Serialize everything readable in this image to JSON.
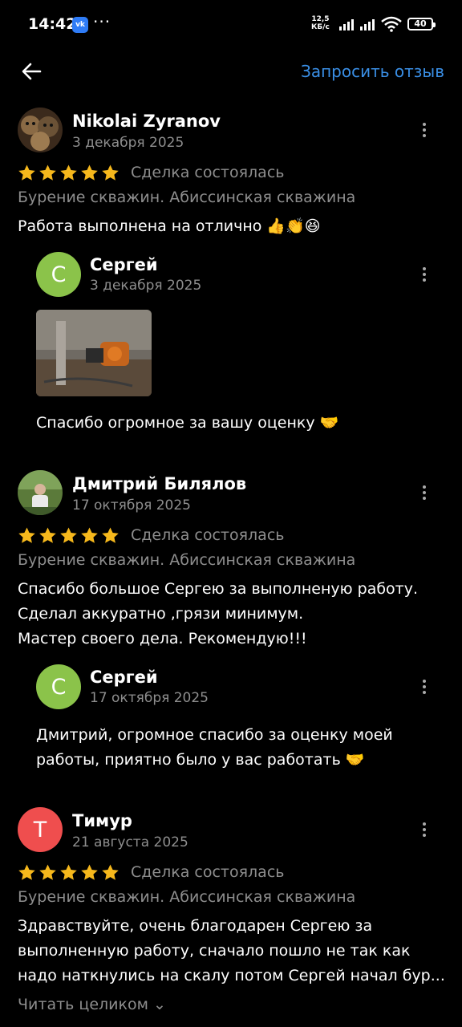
{
  "status_bar": {
    "time": "14:42",
    "app_badge": "vk",
    "more": "···",
    "net_speed_value": "12,5",
    "net_speed_unit": "КБ/с",
    "battery": "40",
    "icons": [
      "signal-icon",
      "signal-icon",
      "wifi-icon",
      "battery-icon"
    ]
  },
  "header": {
    "back_icon": "arrow-left-icon",
    "request_review": "Запросить отзыв"
  },
  "colors": {
    "accent": "#3a8fe6",
    "star": "#f6b81c",
    "avatar_green": "#8bc34a",
    "avatar_red": "#ef4e4e",
    "muted_text": "#8e8e8e"
  },
  "reviews": [
    {
      "author": "Nikolai Zyranov",
      "date": "3 декабря 2025",
      "rating": 5,
      "deal_status": "Сделка состоялась",
      "category": "Бурение скважин. Абиссинская скважина",
      "text": [
        "Работа выполнена на отлично 👍👏😆"
      ],
      "reply": {
        "author": "Сергей",
        "avatar_letter": "С",
        "date": "3 декабря 2025",
        "text": [
          "Спасибо огромное за вашу оценку 🤝"
        ]
      }
    },
    {
      "author": "Дмитрий Билялов",
      "date": "17 октября 2025",
      "rating": 5,
      "deal_status": "Сделка состоялась",
      "category": "Бурение скважин. Абиссинская скважина",
      "text": [
        "Спасибо большое Сергею за выполненую работу.",
        "Сделал аккуратно ,грязи минимум.",
        "Мастер своего дела. Рекомендую!!!"
      ],
      "reply": {
        "author": "Сергей",
        "avatar_letter": "С",
        "date": "17 октября 2025",
        "text": [
          "Дмитрий, огромное спасибо за оценку моей",
          "работы, приятно было у вас работать 🤝"
        ]
      }
    },
    {
      "author": "Тимур",
      "avatar_letter": "Т",
      "date": "21 августа 2025",
      "rating": 5,
      "deal_status": "Сделка состоялась",
      "category": "Бурение скважин. Абиссинская скважина",
      "text": [
        "Здравствуйте, очень благодарен Сергею за",
        "выполненную работу, сначало пошло не так как",
        "надо наткнулись на скалу потом Сергей начал бур..."
      ],
      "read_more": "Читать целиком ⌄"
    }
  ]
}
